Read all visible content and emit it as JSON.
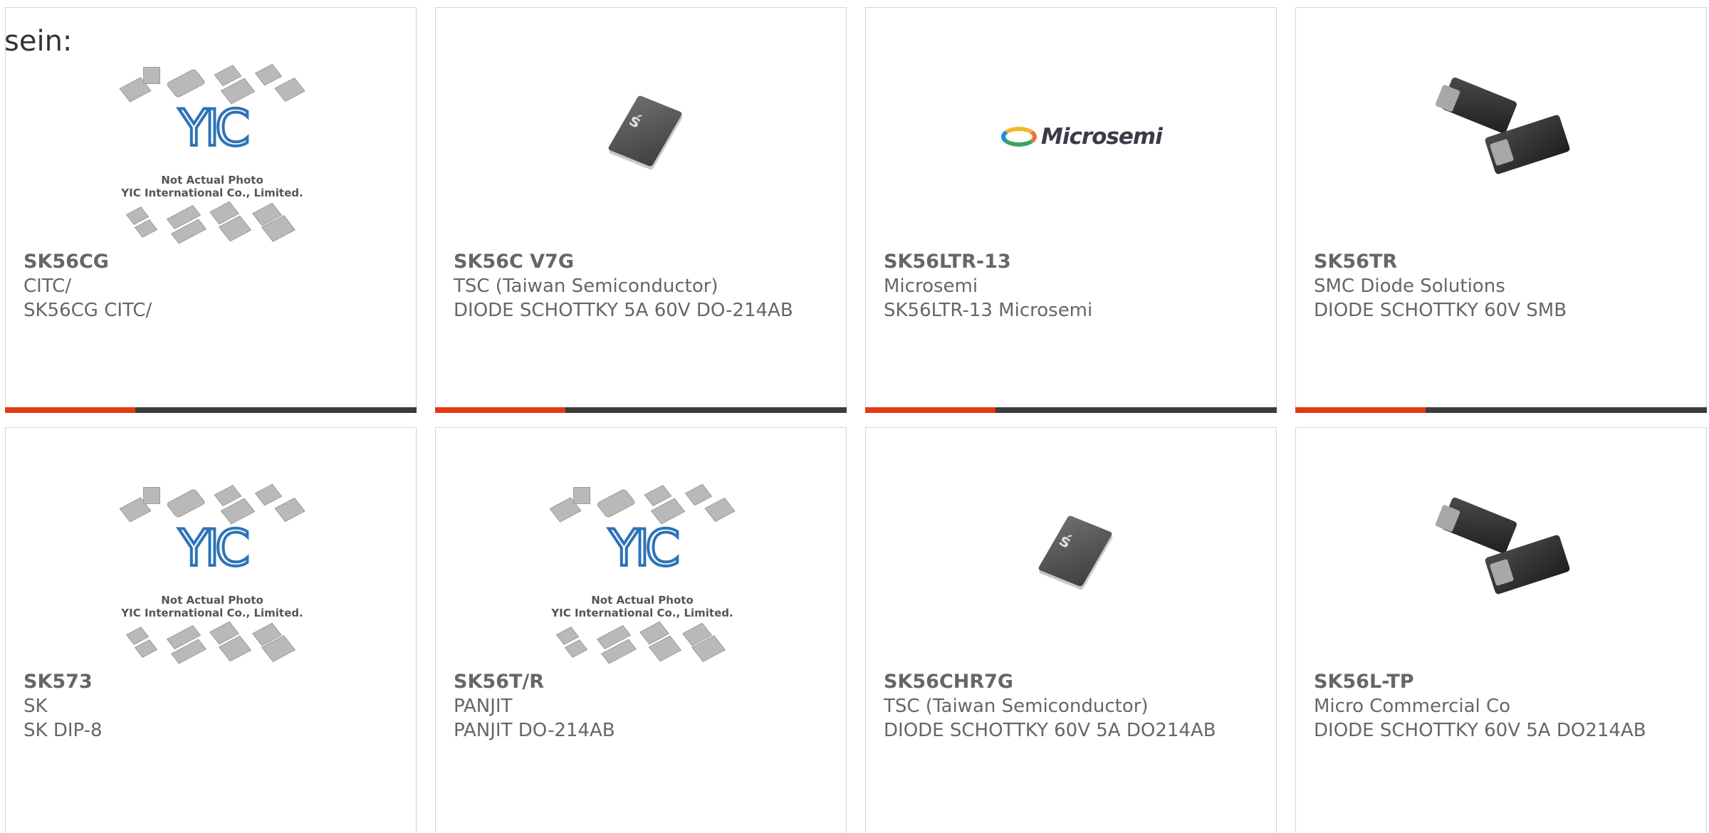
{
  "page": {
    "prefix_text": "sein:"
  },
  "placeholder": {
    "logo": "YIC",
    "caption1": "Not Actual Photo",
    "caption2": "YIC International Co., Limited."
  },
  "microsemi_logo_text": "Microsemi",
  "colors": {
    "accent": "#e33a11",
    "bar": "#3c3c3c",
    "text": "#666666",
    "yic_blue": "#2e73b8"
  },
  "products": [
    {
      "part": "SK56CG",
      "manufacturer": "CITC/",
      "description": "SK56CG CITC/",
      "image": "yic-placeholder"
    },
    {
      "part": "SK56C V7G",
      "manufacturer": "TSC (Taiwan Semiconductor)",
      "description": "DIODE SCHOTTKY 5A 60V DO-214AB",
      "image": "tsc-chip"
    },
    {
      "part": "SK56LTR-13",
      "manufacturer": "Microsemi",
      "description": "SK56LTR-13 Microsemi",
      "image": "microsemi-logo"
    },
    {
      "part": "SK56TR",
      "manufacturer": "SMC Diode Solutions",
      "description": "DIODE SCHOTTKY 60V SMB",
      "image": "smb-diodes"
    },
    {
      "part": "SK573",
      "manufacturer": "SK",
      "description": "SK DIP-8",
      "image": "yic-placeholder"
    },
    {
      "part": "SK56T/R",
      "manufacturer": "PANJIT",
      "description": "PANJIT DO-214AB",
      "image": "yic-placeholder"
    },
    {
      "part": "SK56CHR7G",
      "manufacturer": "TSC (Taiwan Semiconductor)",
      "description": "DIODE SCHOTTKY 60V 5A DO214AB",
      "image": "tsc-chip"
    },
    {
      "part": "SK56L-TP",
      "manufacturer": "Micro Commercial Co",
      "description": "DIODE SCHOTTKY 60V 5A DO214AB",
      "image": "smb-diodes"
    }
  ]
}
